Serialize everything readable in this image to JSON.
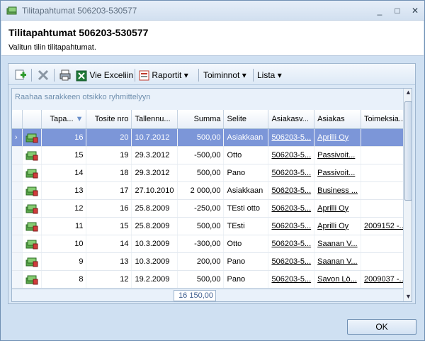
{
  "window": {
    "title": "Tilitapahtumat 506203-530577",
    "minimize": "_",
    "maximize": "□",
    "close": "✕"
  },
  "header": {
    "title": "Tilitapahtumat 506203-530577",
    "subtitle": "Valitun tilin tilitapahtumat."
  },
  "toolbar": {
    "add_icon": "add-icon",
    "delete_icon": "delete-icon",
    "print_icon": "print-icon",
    "excel_label": "Vie Exceliin",
    "reports_label": "Raportit",
    "actions_label": "Toiminnot",
    "list_label": "Lista"
  },
  "grid": {
    "group_hint": "Raahaa sarakkeen otsikko ryhmittelyyn",
    "columns": [
      "Tapa...",
      "Tosite nro",
      "Tallennu...",
      "Summa",
      "Selite",
      "Asiakasv...",
      "Asiakas",
      "Toimeksia..."
    ],
    "rows": [
      {
        "tapa": "16",
        "tosite": "20",
        "tallennus": "10.7.2012",
        "summa": "500,00",
        "selite": "Asiakkaan",
        "asiakasv": "506203-5...",
        "asiakas": "Aprilli Oy",
        "toimeksianto": ""
      },
      {
        "tapa": "15",
        "tosite": "19",
        "tallennus": "29.3.2012",
        "summa": "-500,00",
        "selite": "Otto",
        "asiakasv": "506203-5...",
        "asiakas": "Passivoit...",
        "toimeksianto": ""
      },
      {
        "tapa": "14",
        "tosite": "18",
        "tallennus": "29.3.2012",
        "summa": "500,00",
        "selite": "Pano",
        "asiakasv": "506203-5...",
        "asiakas": "Passivoit...",
        "toimeksianto": ""
      },
      {
        "tapa": "13",
        "tosite": "17",
        "tallennus": "27.10.2010",
        "summa": "2 000,00",
        "selite": "Asiakkaan",
        "asiakasv": "506203-5...",
        "asiakas": "Business ...",
        "toimeksianto": ""
      },
      {
        "tapa": "12",
        "tosite": "16",
        "tallennus": "25.8.2009",
        "summa": "-250,00",
        "selite": "TEsti otto",
        "asiakasv": "506203-5...",
        "asiakas": "Aprilli Oy",
        "toimeksianto": ""
      },
      {
        "tapa": "11",
        "tosite": "15",
        "tallennus": "25.8.2009",
        "summa": "500,00",
        "selite": "TEsti",
        "asiakasv": "506203-5...",
        "asiakas": "Aprilli Oy",
        "toimeksianto": "2009152 -..."
      },
      {
        "tapa": "10",
        "tosite": "14",
        "tallennus": "10.3.2009",
        "summa": "-300,00",
        "selite": "Otto",
        "asiakasv": "506203-5...",
        "asiakas": "Saanan V...",
        "toimeksianto": ""
      },
      {
        "tapa": "9",
        "tosite": "13",
        "tallennus": "10.3.2009",
        "summa": "200,00",
        "selite": "Pano",
        "asiakasv": "506203-5...",
        "asiakas": "Saanan V...",
        "toimeksianto": ""
      },
      {
        "tapa": "8",
        "tosite": "12",
        "tallennus": "19.2.2009",
        "summa": "500,00",
        "selite": "Pano",
        "asiakasv": "506203-5...",
        "asiakas": "Savon Lö...",
        "toimeksianto": "2009037 -..."
      }
    ],
    "total": "16 150,00",
    "selected_row": 0
  },
  "dialog": {
    "ok_label": "OK"
  }
}
